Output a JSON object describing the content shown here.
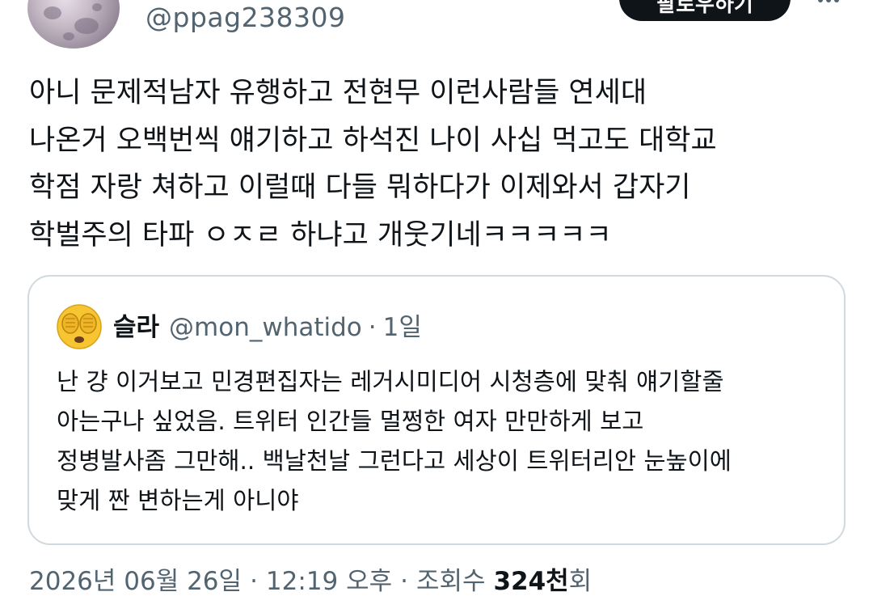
{
  "tweet": {
    "handle": "@ppag238309",
    "follow_label": "팔로우하기",
    "body": "아니 문제적남자 유행하고 전현무 이런사람들 연세대\n나온거 오백번씩 얘기하고 하석진 나이 사십 먹고도 대학교\n학점 자랑 쳐하고 이럴때 다들 뭐하다가 이제와서 갑자기\n학벌주의 타파 ㅇㅈㄹ 하냐고 개웃기네ㅋㅋㅋㅋㅋ"
  },
  "quote": {
    "name": "슬라",
    "handle": "@mon_whatido",
    "time": "1일",
    "body": "난 걍 이거보고 민경편집자는 레거시미디어 시청층에 맞춰 얘기할줄\n아는구나 싶었음. 트위터 인간들 멀쩡한 여자 만만하게 보고\n정병발사좀 그만해.. 백날천날 그런다고 세상이 트위터리안 눈높이에\n맞게 짠 변하는게 아니야"
  },
  "meta": {
    "date": "2026년 06월 26일",
    "time": "12:19 오후",
    "views_label": "조회수",
    "views_count": "324천",
    "views_suffix": "회"
  },
  "separator": "·",
  "icons": {
    "avatar": "moon-avatar",
    "quote_avatar": "face-covering-eyes-emoji",
    "more": "more-horizontal-icon"
  },
  "colors": {
    "text": "#0f1419",
    "secondary": "#536471",
    "border": "#cfd9de",
    "button": "#0f1419"
  }
}
